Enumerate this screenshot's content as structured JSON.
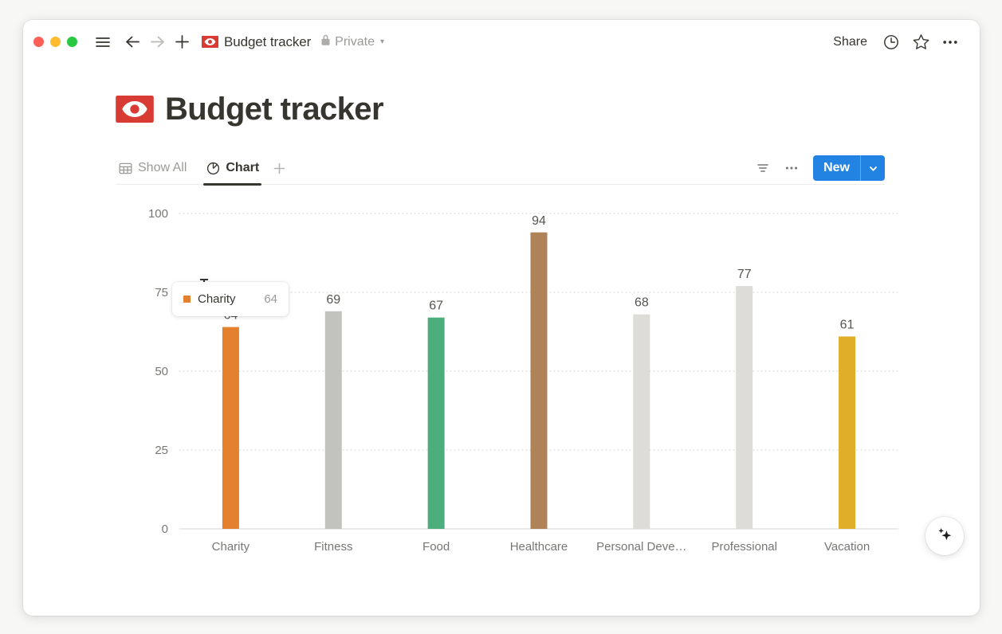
{
  "window": {
    "titlebar": {
      "traffic_lights": [
        "close",
        "minimize",
        "maximize"
      ],
      "sidebar_toggle": "hamburger-icon",
      "back": "back-arrow-icon",
      "forward": "forward-arrow-icon",
      "new_page": "plus-icon",
      "breadcrumb_icon": "money-banknote-icon",
      "breadcrumb_title": "Budget tracker",
      "privacy_icon": "lock-icon",
      "privacy_label": "Private",
      "privacy_chevron": "chevron-down-icon",
      "share_label": "Share",
      "history_icon": "clock-icon",
      "favorite_icon": "star-icon",
      "more_icon": "ellipsis-icon"
    }
  },
  "page": {
    "icon": "money-banknote-icon",
    "title": "Budget tracker"
  },
  "viewbar": {
    "tabs": [
      {
        "label": "Show All",
        "icon": "table-icon",
        "active": false
      },
      {
        "label": "Chart",
        "icon": "pie-chart-icon",
        "active": true
      }
    ],
    "add_view_icon": "plus-icon",
    "filter_icon": "filter-icon",
    "more_icon": "ellipsis-icon",
    "new_label": "New",
    "new_dropdown_icon": "chevron-down-icon"
  },
  "tooltip": {
    "swatch_color": "#e3812e",
    "label": "Charity",
    "value": "64"
  },
  "ai_button": {
    "icon": "sparkles-icon"
  },
  "chart_data": {
    "type": "bar",
    "title": "",
    "xlabel": "",
    "ylabel": "",
    "categories": [
      "Charity",
      "Fitness",
      "Food",
      "Healthcare",
      "Personal Deve…",
      "Professional",
      "Vacation"
    ],
    "values": [
      64,
      69,
      67,
      94,
      68,
      77,
      61
    ],
    "colors": [
      "#e3812e",
      "#c2c2be",
      "#4cae7c",
      "#b08258",
      "#dedcd8",
      "#dedcd8",
      "#e0ae28"
    ],
    "ylim": [
      0,
      100
    ],
    "yticks": [
      0,
      25,
      50,
      75,
      100
    ],
    "ytick_labels": [
      "0",
      "25",
      "50",
      "75",
      "100"
    ],
    "grid": true,
    "grid_style": "dotted",
    "legend": "none",
    "data_labels": true
  }
}
